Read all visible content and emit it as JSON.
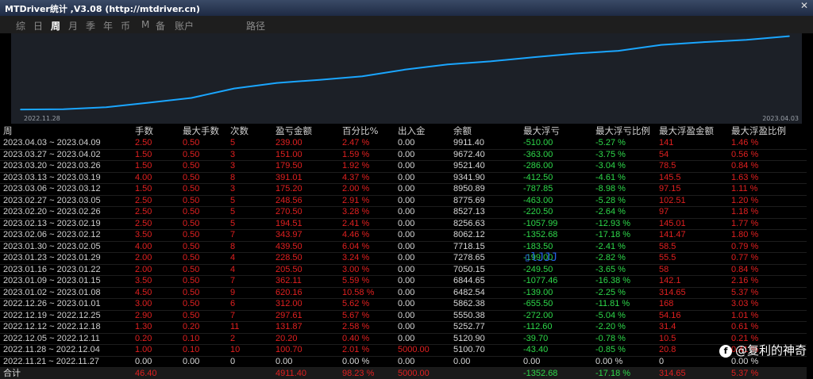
{
  "window": {
    "title": "MTDriver统计 ,V3.08 (http://mtdriver.cn)"
  },
  "tabs": [
    {
      "label": "综",
      "active": false
    },
    {
      "label": "日",
      "active": false
    },
    {
      "label": "周",
      "active": true
    },
    {
      "label": "月",
      "active": false
    },
    {
      "label": "季",
      "active": false
    },
    {
      "label": "年",
      "active": false
    },
    {
      "label": "币",
      "active": false
    },
    {
      "label": "M",
      "active": false
    },
    {
      "label": "备",
      "active": false
    },
    {
      "label": "账户",
      "active": false
    },
    {
      "label": "路径",
      "active": false
    }
  ],
  "chart": {
    "start_date": "2022.11.28",
    "end_date": "2023.04.03",
    "line_color": "#1aa6ff",
    "balance_oldest_to_newest": [
      5100.7,
      5120.9,
      5252.77,
      5550.38,
      5862.38,
      6482.54,
      6844.65,
      7050.15,
      7278.65,
      7718.15,
      8062.12,
      8256.63,
      8527.13,
      8775.69,
      8950.89,
      9341.9,
      9521.4,
      9672.4,
      9911.4
    ]
  },
  "table": {
    "headers": [
      "周",
      "手数",
      "最大手数",
      "次数",
      "盈亏金额",
      "百分比%",
      "出入金",
      "余额",
      "最大浮亏",
      "最大浮亏比例",
      "最大浮盈金额",
      "最大浮盈比例"
    ],
    "rows": [
      [
        "2023.04.03 ~ 2023.04.09",
        "2.50",
        "0.50",
        "5",
        "239.00",
        "2.47 %",
        "0.00",
        "9911.40",
        "-510.00",
        "-5.27 %",
        "141",
        "1.46 %"
      ],
      [
        "2023.03.27 ~ 2023.04.02",
        "1.50",
        "0.50",
        "3",
        "151.00",
        "1.59 %",
        "0.00",
        "9672.40",
        "-363.00",
        "-3.75 %",
        "54",
        "0.56 %"
      ],
      [
        "2023.03.20 ~ 2023.03.26",
        "1.50",
        "0.50",
        "3",
        "179.50",
        "1.92 %",
        "0.00",
        "9521.40",
        "-286.00",
        "-3.04 %",
        "78.5",
        "0.84 %"
      ],
      [
        "2023.03.13 ~ 2023.03.19",
        "4.00",
        "0.50",
        "8",
        "391.01",
        "4.37 %",
        "0.00",
        "9341.90",
        "-412.50",
        "-4.61 %",
        "145.5",
        "1.63 %"
      ],
      [
        "2023.03.06 ~ 2023.03.12",
        "1.50",
        "0.50",
        "3",
        "175.20",
        "2.00 %",
        "0.00",
        "8950.89",
        "-787.85",
        "-8.98 %",
        "97.15",
        "1.11 %"
      ],
      [
        "2023.02.27 ~ 2023.03.05",
        "2.50",
        "0.50",
        "5",
        "248.56",
        "2.91 %",
        "0.00",
        "8775.69",
        "-463.00",
        "-5.28 %",
        "102.51",
        "1.20 %"
      ],
      [
        "2023.02.20 ~ 2023.02.26",
        "2.50",
        "0.50",
        "5",
        "270.50",
        "3.28 %",
        "0.00",
        "8527.13",
        "-220.50",
        "-2.64 %",
        "97",
        "1.18 %"
      ],
      [
        "2023.02.13 ~ 2023.02.19",
        "2.50",
        "0.50",
        "5",
        "194.51",
        "2.41 %",
        "0.00",
        "8256.63",
        "-1057.99",
        "-12.93 %",
        "145.01",
        "1.77 %"
      ],
      [
        "2023.02.06 ~ 2023.02.12",
        "3.50",
        "0.50",
        "7",
        "343.97",
        "4.46 %",
        "0.00",
        "8062.12",
        "-1352.68",
        "-17.18 %",
        "141.47",
        "1.80 %"
      ],
      [
        "2023.01.30 ~ 2023.02.05",
        "4.00",
        "0.50",
        "8",
        "439.50",
        "6.04 %",
        "0.00",
        "7718.15",
        "-183.50",
        "-2.41 %",
        "58.5",
        "0.79 %"
      ],
      [
        "2023.01.23 ~ 2023.01.29",
        "2.00",
        "0.50",
        "4",
        "228.50",
        "3.24 %",
        "0.00",
        "7278.65",
        "-199.00",
        "-2.82 %",
        "55.5",
        "0.77 %"
      ],
      [
        "2023.01.16 ~ 2023.01.22",
        "2.00",
        "0.50",
        "4",
        "205.50",
        "3.00 %",
        "0.00",
        "7050.15",
        "-249.50",
        "-3.65 %",
        "58",
        "0.84 %"
      ],
      [
        "2023.01.09 ~ 2023.01.15",
        "3.50",
        "0.50",
        "7",
        "362.11",
        "5.59 %",
        "0.00",
        "6844.65",
        "-1077.46",
        "-16.38 %",
        "142.1",
        "2.16 %"
      ],
      [
        "2023.01.02 ~ 2023.01.08",
        "4.50",
        "0.50",
        "9",
        "620.16",
        "10.58 %",
        "0.00",
        "6482.54",
        "-139.00",
        "-2.25 %",
        "314.65",
        "5.37 %"
      ],
      [
        "2022.12.26 ~ 2023.01.01",
        "3.00",
        "0.50",
        "6",
        "312.00",
        "5.62 %",
        "0.00",
        "5862.38",
        "-655.50",
        "-11.81 %",
        "168",
        "3.03 %"
      ],
      [
        "2022.12.19 ~ 2022.12.25",
        "2.90",
        "0.50",
        "7",
        "297.61",
        "5.67 %",
        "0.00",
        "5550.38",
        "-272.00",
        "-5.04 %",
        "54.16",
        "1.01 %"
      ],
      [
        "2022.12.12 ~ 2022.12.18",
        "1.30",
        "0.20",
        "11",
        "131.87",
        "2.58 %",
        "0.00",
        "5252.77",
        "-112.60",
        "-2.20 %",
        "31.4",
        "0.61 %"
      ],
      [
        "2022.12.05 ~ 2022.12.11",
        "0.20",
        "0.10",
        "2",
        "20.20",
        "0.40 %",
        "0.00",
        "5120.90",
        "-39.70",
        "-0.78 %",
        "10.5",
        "0.21 %"
      ],
      [
        "2022.11.28 ~ 2022.12.04",
        "1.00",
        "0.10",
        "10",
        "100.70",
        "2.01 %",
        "5000.00",
        "5100.70",
        "-43.40",
        "-0.85 %",
        "20.8",
        "0.41 %"
      ],
      [
        "2022.11.21 ~ 2022.11.27",
        "0.00",
        "0.00",
        "0",
        "0.00",
        "0.00 %",
        "0.00",
        "0.00",
        "0.00",
        "0.00 %",
        "0",
        "0.00 %"
      ]
    ],
    "total": [
      "合计",
      "46.40",
      "",
      "",
      "4911.40",
      "98.23 %",
      "5000.00",
      "",
      "-1352.68",
      "-17.18 %",
      "314.65",
      "5.37 %"
    ]
  },
  "watermark": {
    "icon": "f",
    "text": "@复利的神奇"
  },
  "overlay_glyph": "▯lJJJ",
  "colors": {
    "profit": "#e02020",
    "loss": "#2ed84a",
    "neutral": "#d8d8d8"
  }
}
